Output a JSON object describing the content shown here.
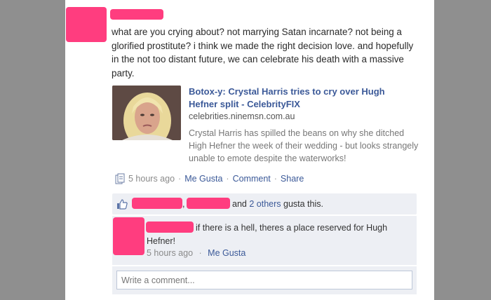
{
  "post": {
    "text": "what are you crying about? not marrying Satan incarnate? not being a glorified prostitute? i think we made the right decision love. and hopefully in the not too distant future, we can celebrate his death with a massive party.",
    "link": {
      "title": "Botox-y: Crystal Harris tries to cry over Hugh Hefner split - CelebrityFIX",
      "domain": "celebrities.ninemsn.com.au",
      "description": "Crystal Harris has spilled the beans on why she ditched High Hefner the week of their wedding - but looks strangely unable to emote despite the waterworks!"
    },
    "meta": {
      "time": "5 hours ago",
      "like_label": "Me Gusta",
      "comment_label": "Comment",
      "share_label": "Share"
    }
  },
  "likes": {
    "and_text": "and",
    "others_link": "2 others",
    "suffix": "gusta this."
  },
  "comment": {
    "text": "if there is a hell, theres a place reserved for Hugh Hefner!",
    "time": "5 hours ago",
    "like_label": "Me Gusta"
  },
  "composer": {
    "placeholder": "Write a comment..."
  },
  "colors": {
    "redaction": "#ff3d7f",
    "link": "#3b5998",
    "background": "#8f8f8f"
  },
  "icons": [
    "share-link-icon",
    "thumbs-up-icon"
  ]
}
